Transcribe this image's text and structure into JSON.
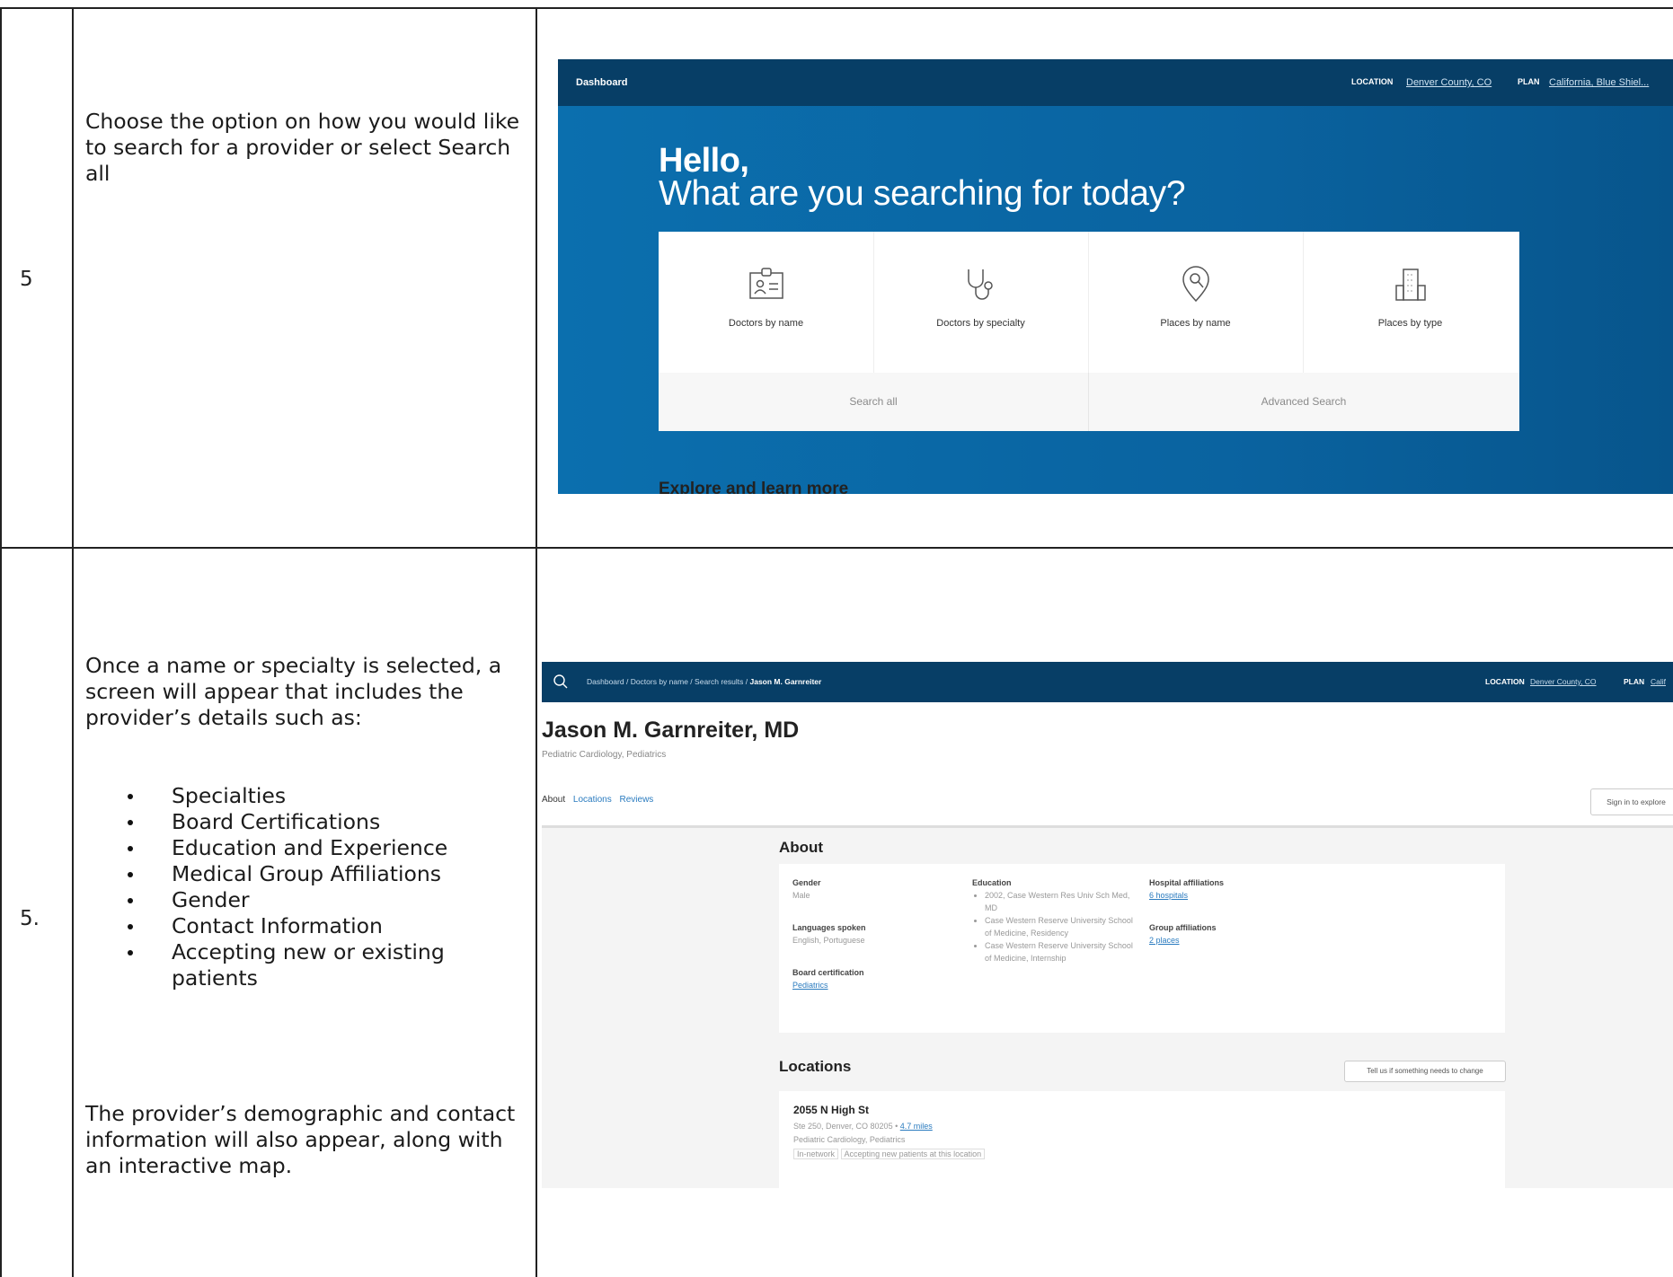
{
  "rows": [
    {
      "step": "5",
      "description": "Choose the option on how you would like to search for a provider or select Search all"
    },
    {
      "step": "5.",
      "intro": "Once a name or specialty is selected, a screen will appear that includes the provider’s details such as:",
      "bullets": [
        "Specialties",
        "Board Certifications",
        "Education and Experience",
        "Medical Group Affiliations",
        "Gender",
        "Contact Information",
        "Accepting new or existing patients"
      ],
      "outro": "The provider’s demographic and contact information will also appear, along with an interactive map."
    }
  ],
  "screen1": {
    "nav_title": "Dashboard",
    "location_label": "LOCATION",
    "location_value": "Denver County, CO",
    "plan_label": "PLAN",
    "plan_value": "California, Blue Shiel...",
    "greeting": "Hello,",
    "question": "What are you searching for today?",
    "options": [
      {
        "label": "Doctors by name",
        "icon": "id-badge-icon"
      },
      {
        "label": "Doctors by specialty",
        "icon": "stethoscope-icon"
      },
      {
        "label": "Places by name",
        "icon": "map-pin-search-icon"
      },
      {
        "label": "Places by type",
        "icon": "building-icon"
      }
    ],
    "search_all": "Search all",
    "advanced_search": "Advanced Search",
    "explore": "Explore and learn more"
  },
  "screen2": {
    "breadcrumb": [
      "Dashboard /",
      "Doctors by name /",
      "Search results /",
      "Jason M. Garnreiter"
    ],
    "location_label": "LOCATION",
    "location_value": "Denver County, CO",
    "plan_label": "PLAN",
    "plan_value": "Calif",
    "provider_name": "Jason M. Garnreiter, MD",
    "provider_specialties": "Pediatric Cardiology, Pediatrics",
    "tabs": [
      "About",
      "Locations",
      "Reviews"
    ],
    "signin": "Sign in to explore",
    "about_heading": "About",
    "gender_label": "Gender",
    "gender_value": "Male",
    "languages_label": "Languages spoken",
    "languages_value": "English, Portuguese",
    "board_label": "Board certification",
    "board_value": "Pediatrics",
    "education_label": "Education",
    "education_items": [
      "2002, Case Western Res Univ Sch Med, MD",
      "Case Western Reserve University School of Medicine, Residency",
      "Case Western Reserve University School of Medicine, Internship"
    ],
    "hospital_label": "Hospital affiliations",
    "hospital_value": "6 hospitals",
    "group_label": "Group affiliations",
    "group_value": "2 places",
    "locations_heading": "Locations",
    "tell_us": "Tell us if something needs to change",
    "address_title": "2055 N High St",
    "address_line": "Ste 250, Denver, CO 80205 •",
    "distance": "4.7 miles",
    "address_specialties": "Pediatric Cardiology, Pediatrics",
    "network_badge": "In-network",
    "accepting": "Accepting new patients at this location"
  },
  "colors": {
    "nav": "#073e66",
    "hero": "#0a6aa8",
    "link": "#2a7bbf"
  }
}
